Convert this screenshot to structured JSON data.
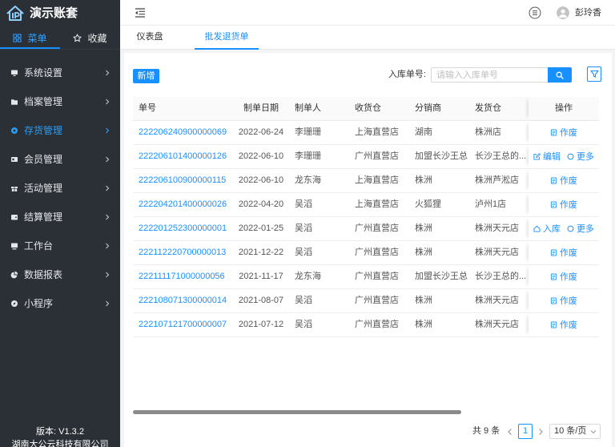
{
  "app": {
    "title": "演示账套",
    "logo_icon": "house-logo-icon"
  },
  "sidebar": {
    "tabs": [
      {
        "label": "菜单",
        "icon": "grid-icon",
        "active": true
      },
      {
        "label": "收藏",
        "icon": "star-icon",
        "active": false
      }
    ],
    "items": [
      {
        "label": "系统设置",
        "icon": "monitor-icon",
        "active": false
      },
      {
        "label": "档案管理",
        "icon": "folder-icon",
        "active": false
      },
      {
        "label": "存货管理",
        "icon": "cube-icon",
        "active": true
      },
      {
        "label": "会员管理",
        "icon": "id-card-icon",
        "active": false
      },
      {
        "label": "活动管理",
        "icon": "gift-icon",
        "active": false
      },
      {
        "label": "结算管理",
        "icon": "wallet-icon",
        "active": false
      },
      {
        "label": "工作台",
        "icon": "desktop-icon",
        "active": false
      },
      {
        "label": "数据报表",
        "icon": "pie-chart-icon",
        "active": false
      },
      {
        "label": "小程序",
        "icon": "compass-icon",
        "active": false
      }
    ],
    "version": "版本: V1.3.2",
    "company": "湖南大公云科技有限公司"
  },
  "topbar": {
    "user_name": "彭玲香"
  },
  "nav_tabs": [
    {
      "label": "仪表盘",
      "active": false
    },
    {
      "label": "批发退货单",
      "active": true
    }
  ],
  "toolbar": {
    "add_label": "新增",
    "search_label": "入库单号:",
    "search_placeholder": "请输入入库单号"
  },
  "table": {
    "columns": [
      "单号",
      "制单日期",
      "制单人",
      "收货仓",
      "分销商",
      "发货仓",
      "操作"
    ],
    "rows": [
      {
        "no": "222206240900000069",
        "date": "2022-06-24",
        "maker": "李珊珊",
        "recv": "上海直营店",
        "dist": "湖南",
        "send": "株洲店",
        "ops": [
          {
            "label": "作废",
            "icon": "void-icon"
          }
        ]
      },
      {
        "no": "222206101400000126",
        "date": "2022-06-10",
        "maker": "李珊珊",
        "recv": "广州直营店",
        "dist": "加盟长沙王总",
        "send": "长沙王总的...",
        "ops": [
          {
            "label": "编辑",
            "icon": "edit-icon"
          },
          {
            "label": "更多",
            "icon": "more-icon"
          }
        ]
      },
      {
        "no": "222206100900000115",
        "date": "2022-06-10",
        "maker": "龙东海",
        "recv": "上海直营店",
        "dist": "株洲",
        "send": "株洲芦淞店",
        "ops": [
          {
            "label": "作废",
            "icon": "void-icon"
          }
        ]
      },
      {
        "no": "222204201400000026",
        "date": "2022-04-20",
        "maker": "吴滔",
        "recv": "上海直营店",
        "dist": "火狐狸",
        "send": "泸州1店",
        "ops": [
          {
            "label": "作废",
            "icon": "void-icon"
          }
        ]
      },
      {
        "no": "222201252300000001",
        "date": "2022-01-25",
        "maker": "吴滔",
        "recv": "广州直营店",
        "dist": "株洲",
        "send": "株洲天元店",
        "ops": [
          {
            "label": "入库",
            "icon": "inbound-icon"
          },
          {
            "label": "更多",
            "icon": "more-icon"
          }
        ]
      },
      {
        "no": "222112220700000013",
        "date": "2021-12-22",
        "maker": "吴滔",
        "recv": "广州直营店",
        "dist": "株洲",
        "send": "株洲天元店",
        "ops": [
          {
            "label": "作废",
            "icon": "void-icon"
          }
        ]
      },
      {
        "no": "222111171000000056",
        "date": "2021-11-17",
        "maker": "龙东海",
        "recv": "广州直营店",
        "dist": "加盟长沙王总",
        "send": "长沙王总的...",
        "ops": [
          {
            "label": "作废",
            "icon": "void-icon"
          }
        ]
      },
      {
        "no": "222108071300000014",
        "date": "2021-08-07",
        "maker": "吴滔",
        "recv": "广州直营店",
        "dist": "株洲",
        "send": "株洲天元店",
        "ops": [
          {
            "label": "作废",
            "icon": "void-icon"
          }
        ]
      },
      {
        "no": "222107121700000007",
        "date": "2021-07-12",
        "maker": "吴滔",
        "recv": "广州直营店",
        "dist": "株洲",
        "send": "株洲天元店",
        "ops": [
          {
            "label": "作废",
            "icon": "void-icon"
          }
        ]
      }
    ]
  },
  "pagination": {
    "total": "共 9 条",
    "current_page": "1",
    "page_size": "10 条/页"
  },
  "colors": {
    "primary": "#1890ff",
    "sidebar_bg": "#2b2f36",
    "active_menu": "#2d9cf0"
  }
}
